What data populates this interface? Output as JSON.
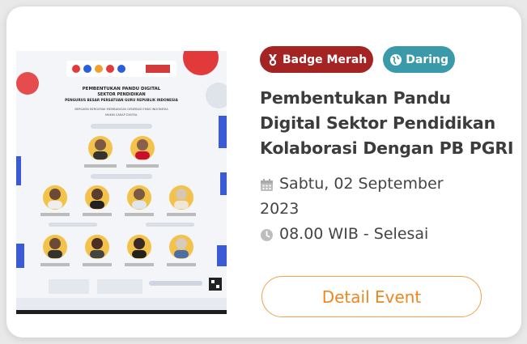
{
  "event": {
    "badges": {
      "red": {
        "label": "Badge Merah",
        "icon": "medal-icon",
        "color": "#a42323"
      },
      "mode": {
        "label": "Daring",
        "icon": "globe-icon",
        "color": "#3a9aa9"
      }
    },
    "title_lines": [
      "Pembentukan Pandu",
      "Digital Sektor Pendidikan",
      "Kolaborasi Dengan PB PGRI"
    ],
    "date_lines": [
      "Sabtu, 02 September",
      "2023"
    ],
    "time": "08.00 WIB - Selesai",
    "button_label": "Detail Event",
    "accent_color": "#f0861e"
  },
  "poster": {
    "title_lines": [
      "PEMBENTUKAN PANDU DIGITAL",
      "SEKTOR PENDIDIKAN",
      "PENGURUS BESAR PERSATUAN GURU REPUBLIK INDONESIA"
    ],
    "tagline": "BERSAMA BERGERAK MEMBANGUN GENERASI EMAS INDONESIA",
    "subtitle": "MAKIN CAKAP DIGITAL"
  }
}
